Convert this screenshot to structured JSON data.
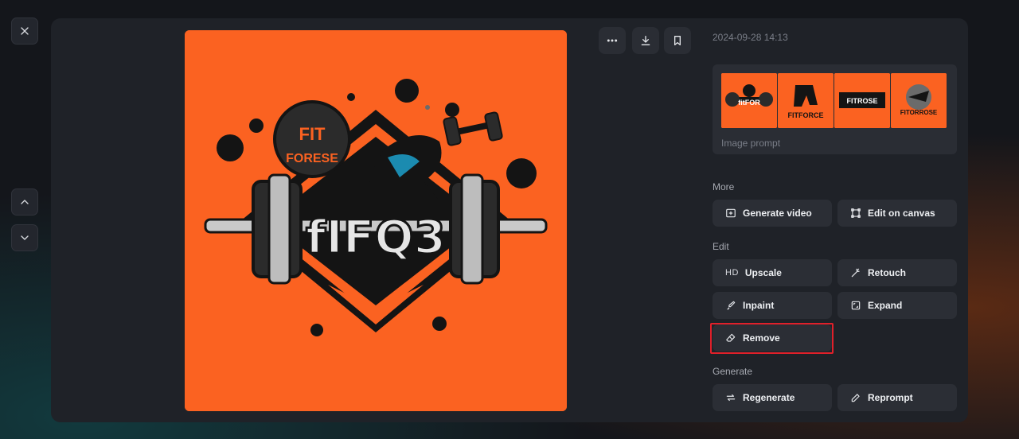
{
  "timestamp": "2024-09-28 14:13",
  "prompt_box": {
    "label": "Image prompt"
  },
  "sections": {
    "more": "More",
    "edit": "Edit",
    "generate": "Generate"
  },
  "actions": {
    "generate_video": "Generate video",
    "edit_on_canvas": "Edit on canvas",
    "upscale": "Upscale",
    "upscale_badge": "HD",
    "retouch": "Retouch",
    "inpaint": "Inpaint",
    "expand": "Expand",
    "remove": "Remove",
    "regenerate": "Regenerate",
    "reprompt": "Reprompt"
  },
  "image": {
    "logo_top": "FIT",
    "logo_sub": "FORESE",
    "logo_main": "fIFQ3"
  },
  "thumbnails": [
    {
      "text": "fitFOR"
    },
    {
      "text": "FITFORCE"
    },
    {
      "text": "FITROSE"
    },
    {
      "text": "FITORROSE"
    }
  ],
  "colors": {
    "accent_orange": "#fb6221",
    "panel": "#1f2228",
    "button": "#2b2e35",
    "highlight": "#e0202a"
  },
  "icons": {
    "close": "close-icon",
    "up": "chevron-up-icon",
    "down": "chevron-down-icon",
    "more": "more-horizontal-icon",
    "download": "download-icon",
    "bookmark": "bookmark-icon"
  }
}
